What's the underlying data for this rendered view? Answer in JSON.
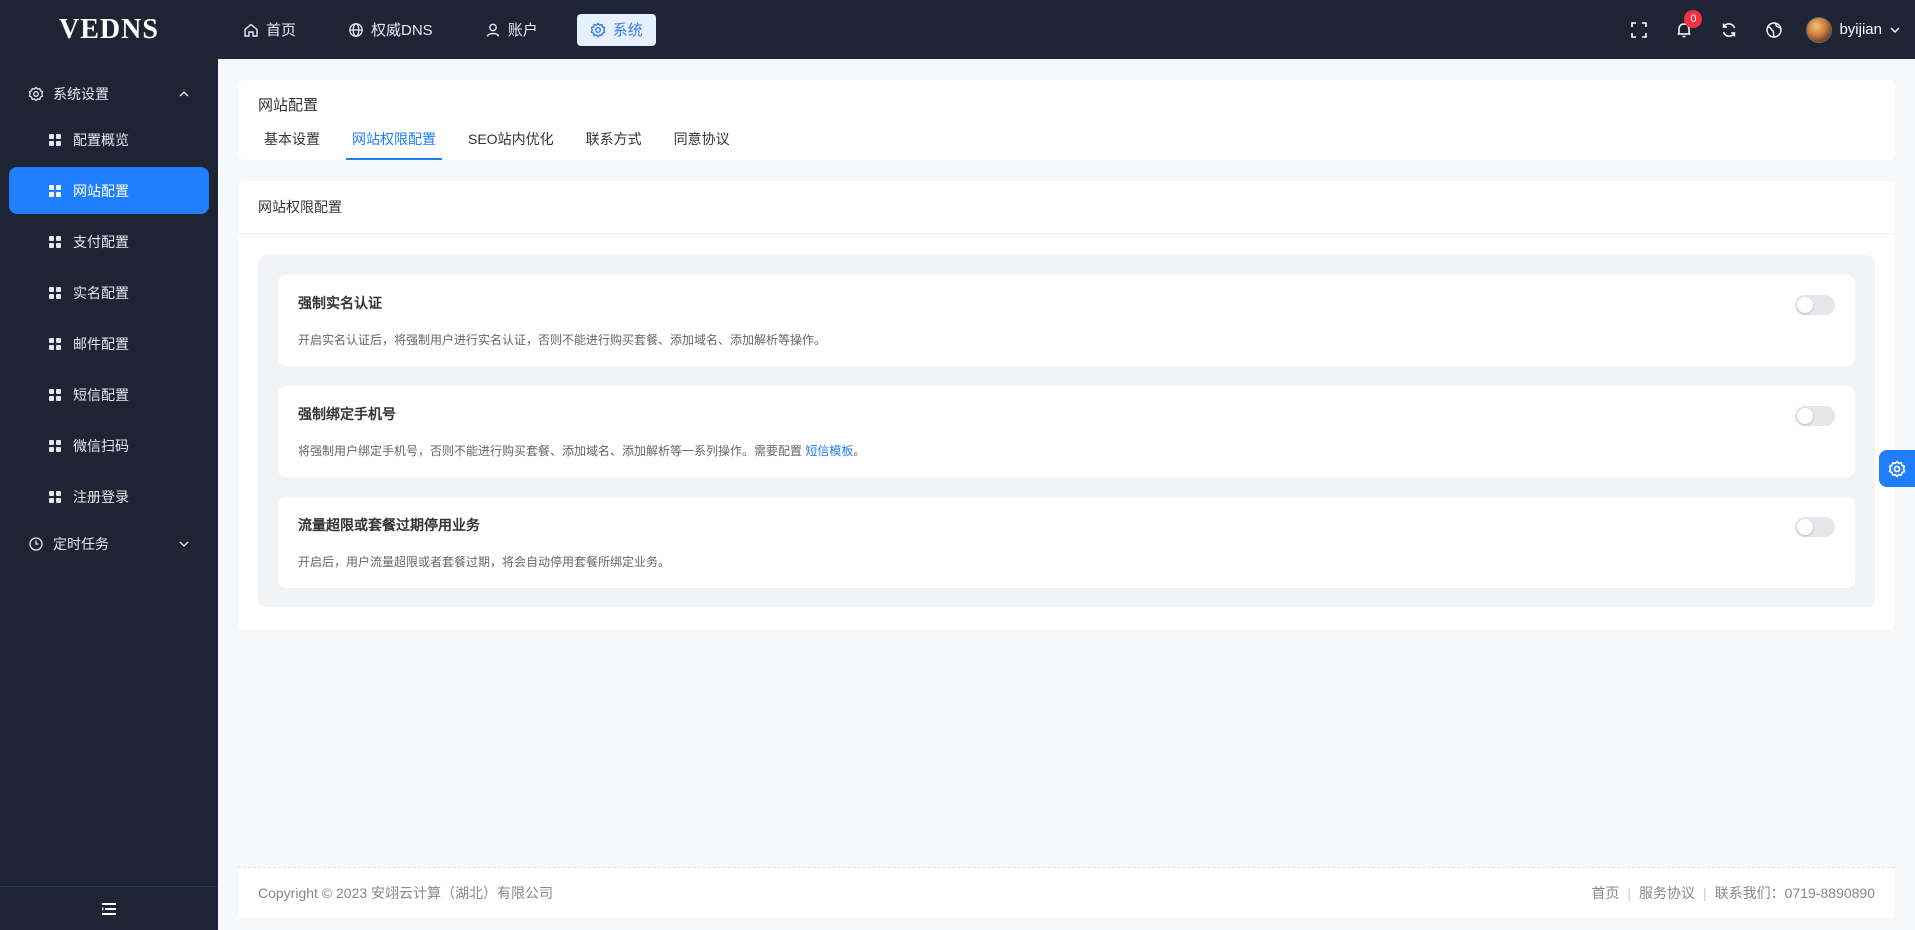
{
  "brand": {
    "logo": "VEDNS"
  },
  "topnav": [
    {
      "label": "首页",
      "icon": "home-icon"
    },
    {
      "label": "权威DNS",
      "icon": "globe-icon"
    },
    {
      "label": "账户",
      "icon": "user-icon"
    },
    {
      "label": "系统",
      "icon": "gear-icon",
      "active": true
    }
  ],
  "header_tools": {
    "notification_count": "0",
    "username": "byijian"
  },
  "sidebar": {
    "group1": {
      "label": "系统设置",
      "expanded": true
    },
    "items": [
      {
        "label": "配置概览"
      },
      {
        "label": "网站配置",
        "active": true
      },
      {
        "label": "支付配置"
      },
      {
        "label": "实名配置"
      },
      {
        "label": "邮件配置"
      },
      {
        "label": "短信配置"
      },
      {
        "label": "微信扫码"
      },
      {
        "label": "注册登录"
      }
    ],
    "group2": {
      "label": "定时任务",
      "expanded": false
    }
  },
  "page": {
    "title": "网站配置",
    "tabs": [
      {
        "label": "基本设置"
      },
      {
        "label": "网站权限配置",
        "active": true
      },
      {
        "label": "SEO站内优化"
      },
      {
        "label": "联系方式"
      },
      {
        "label": "同意协议"
      }
    ]
  },
  "settings": {
    "heading": "网站权限配置",
    "rows": [
      {
        "title": "强制实名认证",
        "desc": "开启实名认证后，将强制用户进行实名认证，否则不能进行购买套餐、添加域名、添加解析等操作。",
        "enabled": false
      },
      {
        "title": "强制绑定手机号",
        "desc": "将强制用户绑定手机号，否则不能进行购买套餐、添加域名、添加解析等一系列操作。需要配置 ",
        "link": "短信模板",
        "desc_end": "。",
        "enabled": false
      },
      {
        "title": "流量超限或套餐过期停用业务",
        "desc": "开启后，用户流量超限或者套餐过期，将会自动停用套餐所绑定业务。",
        "enabled": false
      }
    ]
  },
  "footer": {
    "copyright": "Copyright © 2023 安翊云计算（湖北）有限公司",
    "links": [
      "首页",
      "服务协议",
      "联系我们：0719-8890890"
    ],
    "separator": "|"
  },
  "colors": {
    "topbar": "#1e2433",
    "accent": "#1e7efb",
    "badge": "#f2303f"
  }
}
